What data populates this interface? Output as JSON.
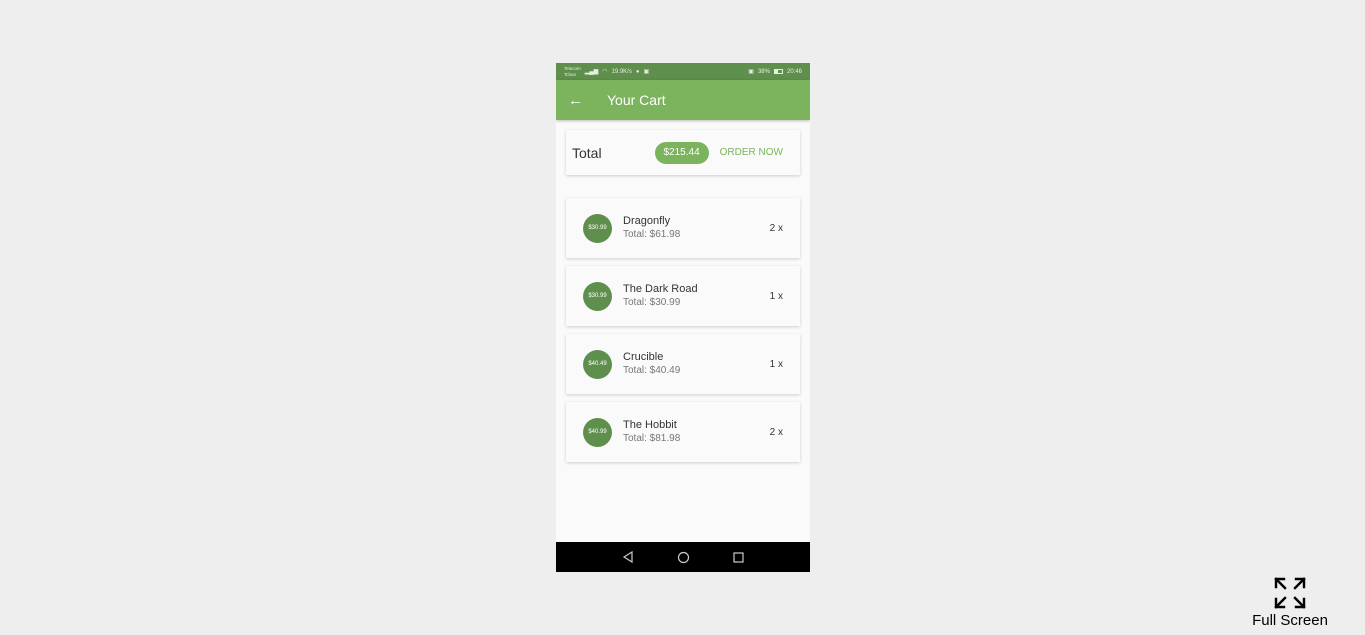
{
  "status_bar": {
    "carrier_line1": "Telecom",
    "carrier_line2": "Tchun",
    "net_speed": "19.9K/s",
    "battery": "38%",
    "time": "20:46"
  },
  "app_bar": {
    "title": "Your Cart"
  },
  "total": {
    "label": "Total",
    "amount": "$215.44",
    "order_label": "ORDER NOW"
  },
  "items": [
    {
      "price": "$30.99",
      "title": "Dragonfly",
      "subtitle": "Total: $61.98",
      "qty": "2 x"
    },
    {
      "price": "$30.99",
      "title": "The Dark Road",
      "subtitle": "Total: $30.99",
      "qty": "1 x"
    },
    {
      "price": "$40.49",
      "title": "Crucible",
      "subtitle": "Total: $40.49",
      "qty": "1 x"
    },
    {
      "price": "$40.99",
      "title": "The Hobbit",
      "subtitle": "Total: $81.98",
      "qty": "2 x"
    }
  ],
  "fullscreen": {
    "label": "Full Screen"
  },
  "colors": {
    "primary": "#7cb35d",
    "primary_dark": "#5f8f4c",
    "background": "#eeeeee",
    "surface": "#fafafa"
  }
}
